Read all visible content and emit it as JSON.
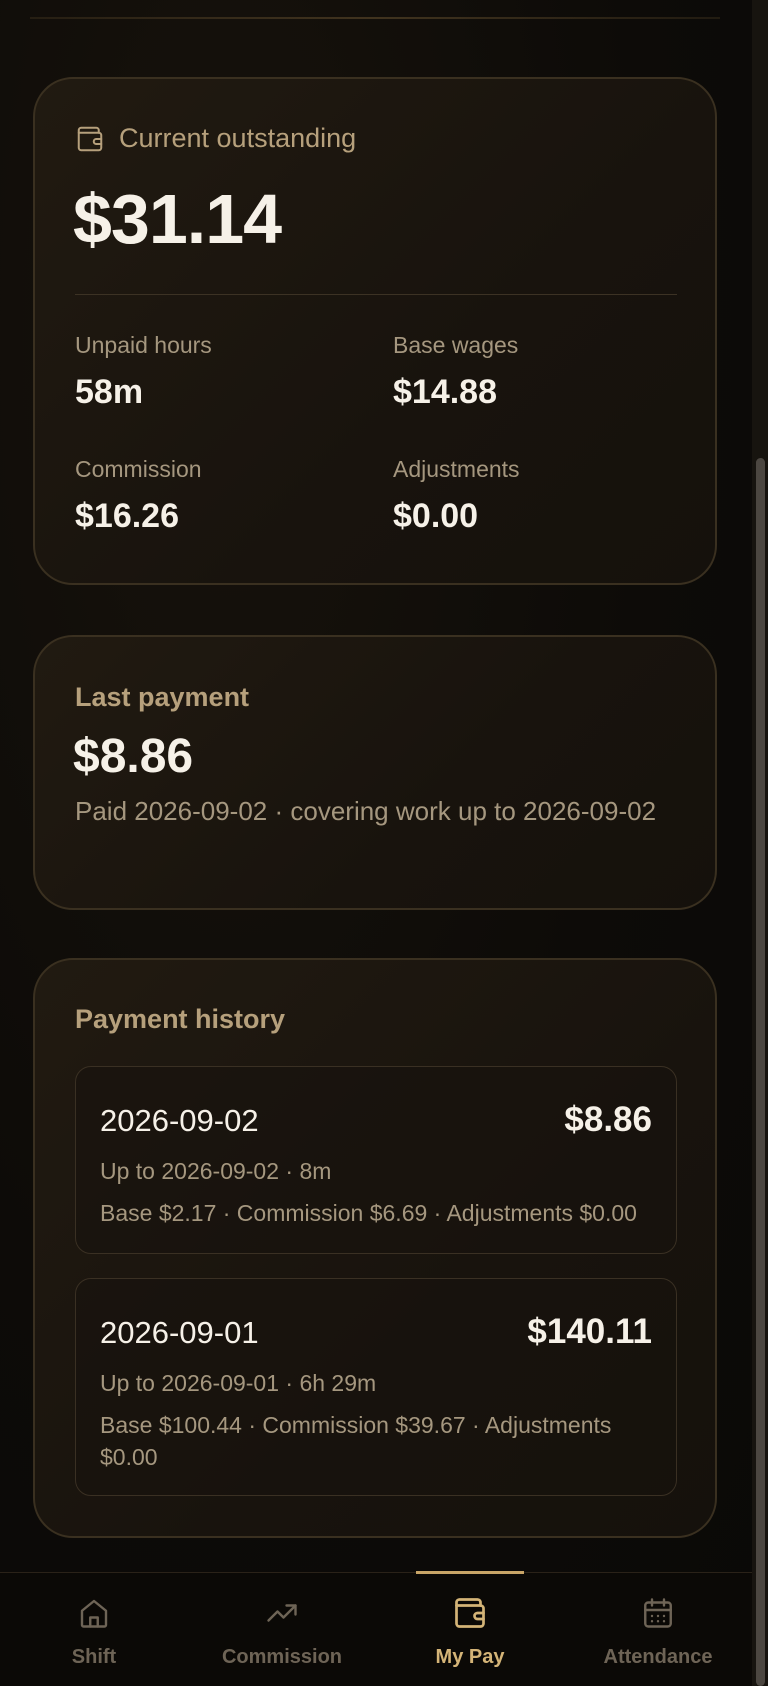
{
  "outstanding": {
    "title": "Current outstanding",
    "amount": "$31.14",
    "stats": {
      "unpaid_hours_label": "Unpaid hours",
      "unpaid_hours_value": "58m",
      "base_wages_label": "Base wages",
      "base_wages_value": "$14.88",
      "commission_label": "Commission",
      "commission_value": "$16.26",
      "adjustments_label": "Adjustments",
      "adjustments_value": "$0.00"
    }
  },
  "last_payment": {
    "title": "Last payment",
    "amount": "$8.86",
    "note": "Paid 2026-09-02 · covering work up to 2026-09-02"
  },
  "history": {
    "title": "Payment history",
    "entries": [
      {
        "date": "2026-09-02",
        "amount": "$8.86",
        "sub": "Up to 2026-09-02 · 8m",
        "breakdown": "Base $2.17 · Commission $6.69 · Adjustments $0.00"
      },
      {
        "date": "2026-09-01",
        "amount": "$140.11",
        "sub": "Up to 2026-09-01 · 6h 29m",
        "breakdown": "Base $100.44 · Commission $39.67 · Adjustments $0.00"
      }
    ]
  },
  "nav": {
    "items": [
      {
        "label": "Shift",
        "icon": "home-icon",
        "active": false
      },
      {
        "label": "Commission",
        "icon": "trending-up-icon",
        "active": false
      },
      {
        "label": "My Pay",
        "icon": "wallet-icon",
        "active": true
      },
      {
        "label": "Attendance",
        "icon": "calendar-icon",
        "active": false
      }
    ]
  },
  "colors": {
    "accent": "#d4b477",
    "muted": "#a5977f",
    "text": "#f6f1e8",
    "inactive_nav": "#6e6456"
  }
}
